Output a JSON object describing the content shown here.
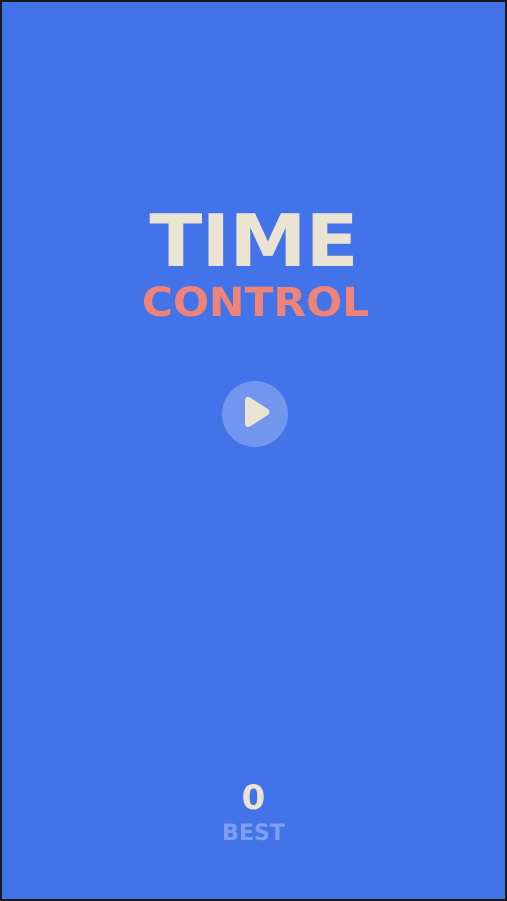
{
  "game": {
    "title_line1": "TIME",
    "title_line2": "CONTROL",
    "play_icon": "play-icon",
    "best_score": "0",
    "best_label": "BEST"
  },
  "colors": {
    "background": "#4373e8",
    "title_primary": "#ece4d3",
    "title_accent": "#f08377",
    "best_label": "#7ea0ee"
  }
}
